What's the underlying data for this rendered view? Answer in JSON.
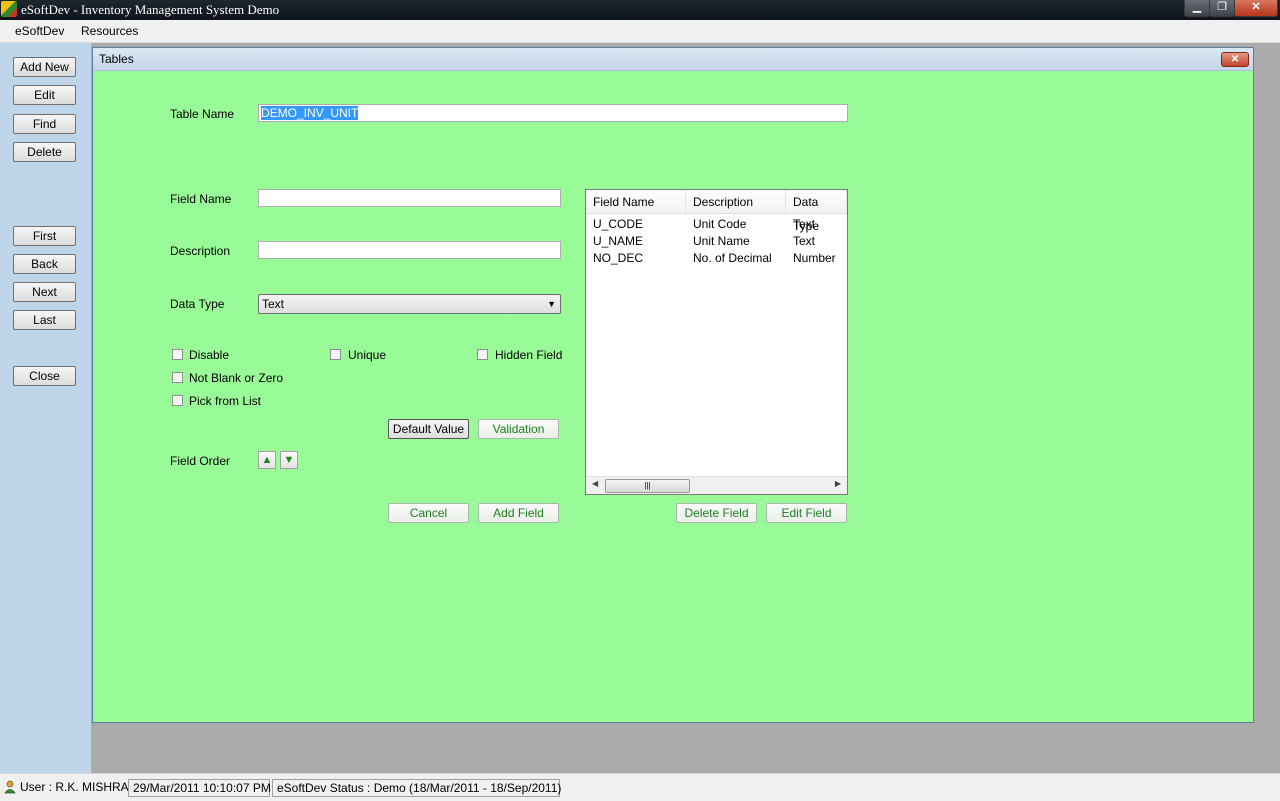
{
  "window": {
    "title": "eSoftDev - Inventory Management System Demo"
  },
  "menu": {
    "items": [
      "eSoftDev",
      "Resources"
    ]
  },
  "sidebar": {
    "buttons": [
      "Add New",
      "Edit",
      "Find",
      "Delete",
      "First",
      "Back",
      "Next",
      "Last",
      "Close"
    ]
  },
  "form": {
    "title": "Tables",
    "table_name_label": "Table Name",
    "table_name_value": "DEMO_INV_UNIT",
    "field_name_label": "Field Name",
    "field_name_value": "",
    "description_label": "Description",
    "description_value": "",
    "data_type_label": "Data Type",
    "data_type_value": "Text",
    "checkboxes": {
      "disable": "Disable",
      "unique": "Unique",
      "hidden": "Hidden Field",
      "not_blank": "Not Blank or Zero",
      "pick_list": "Pick from List"
    },
    "default_value_button": "Default Value",
    "validation_button": "Validation",
    "field_order_label": "Field Order",
    "cancel_button": "Cancel",
    "add_field_button": "Add Field",
    "delete_field_button": "Delete Field",
    "edit_field_button": "Edit Field"
  },
  "grid": {
    "columns": [
      "Field Name",
      "Description",
      "Data Type"
    ],
    "rows": [
      [
        "U_CODE",
        "Unit Code",
        "Text"
      ],
      [
        "U_NAME",
        "Unit Name",
        "Text"
      ],
      [
        "NO_DEC",
        "No. of Decimal",
        "Number"
      ]
    ]
  },
  "status": {
    "user": "User : R.K. MISHRA",
    "datetime": "29/Mar/2011 10:10:07 PM",
    "status": "eSoftDev Status : Demo (18/Mar/2011 - 18/Sep/2011)"
  }
}
